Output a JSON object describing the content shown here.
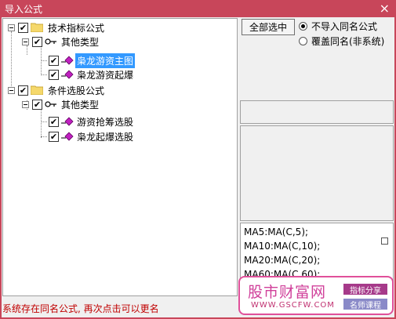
{
  "window": {
    "title": "导入公式",
    "close_glyph": "×"
  },
  "tree": {
    "root1": {
      "label": "技术指标公式",
      "checked": true,
      "group": {
        "label": "其他类型",
        "items": [
          {
            "label": "枭龙游资主图",
            "selected": true
          },
          {
            "label": "枭龙游资起爆"
          }
        ]
      }
    },
    "root2": {
      "label": "条件选股公式",
      "checked": true,
      "group": {
        "label": "其他类型",
        "items": [
          {
            "label": "游资抢筹选股"
          },
          {
            "label": "枭龙起爆选股"
          }
        ]
      }
    },
    "check_glyph": "✔"
  },
  "buttons": {
    "select_all": "全部选中"
  },
  "options": {
    "no_import": "不导入同名公式",
    "overwrite": "覆盖同名(非系统)",
    "selected": "no_import"
  },
  "code_lines": [
    "MA5:MA(C,5);",
    "MA10:MA(C,10);",
    "MA20:MA(C,20);",
    "MA60:MA(C,60);"
  ],
  "status": "系统存在同名公式, 再次点击可以更名",
  "watermark": {
    "brand": "股市财富网",
    "url": "WWW.GSCFW.COM",
    "tag1": "指标分享",
    "tag2": "名师课程",
    "color": "#e0509a"
  },
  "colors": {
    "titlebar": "#c8465a",
    "selection": "#3399ff",
    "status": "#c00000"
  }
}
